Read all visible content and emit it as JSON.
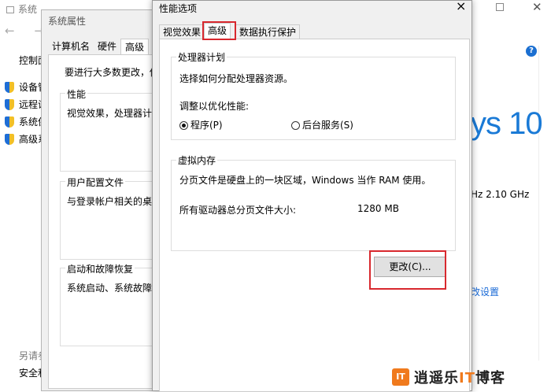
{
  "system_window": {
    "title": "系统",
    "nav_arrows": "← →",
    "control_panel": "控制面",
    "sidebar": [
      {
        "label": "设备管"
      },
      {
        "label": "远程设"
      },
      {
        "label": "系统保"
      },
      {
        "label": "高级系"
      }
    ],
    "see_also": "另请参",
    "security": "安全和",
    "windows_logo_text": "ys 10",
    "cpu_speed": "Hz   2.10 GHz",
    "change_settings": "改设置",
    "help_icon": "?"
  },
  "system_properties": {
    "title": "系统属性",
    "tabs": [
      "计算机名",
      "硬件",
      "高级"
    ],
    "admin_note": "要进行大多数更改，你",
    "groups": [
      {
        "label": "性能",
        "text": "视觉效果，处理器计划"
      },
      {
        "label": "用户配置文件",
        "text": "与登录帐户相关的桌面"
      },
      {
        "label": "启动和故障恢复",
        "text": "系统启动、系统故障和"
      }
    ]
  },
  "performance_options": {
    "title": "性能选项",
    "close": "×",
    "tabs": [
      {
        "label": "视觉效果",
        "selected": false
      },
      {
        "label": "高级",
        "selected": true
      },
      {
        "label": "数据执行保护",
        "selected": false
      }
    ],
    "processor_group": {
      "label": "处理器计划",
      "desc": "选择如何分配处理器资源。",
      "adjust_label": "调整以优化性能:",
      "options": [
        {
          "label": "程序(P)",
          "checked": true
        },
        {
          "label": "后台服务(S)",
          "checked": false
        }
      ]
    },
    "virtual_memory": {
      "label": "虚拟内存",
      "desc": "分页文件是硬盘上的一块区域，Windows 当作 RAM 使用。",
      "total_label": "所有驱动器总分页文件大小:",
      "total_value": "1280 MB",
      "change_button": "更改(C)..."
    }
  },
  "watermark": {
    "logo": "IT",
    "name_prefix": "逍遥乐",
    "name_it": "IT",
    "name_suffix": "博客"
  },
  "colors": {
    "highlight": "#d8282e",
    "accent": "#1a7ad6",
    "brand": "#f07a1d"
  }
}
